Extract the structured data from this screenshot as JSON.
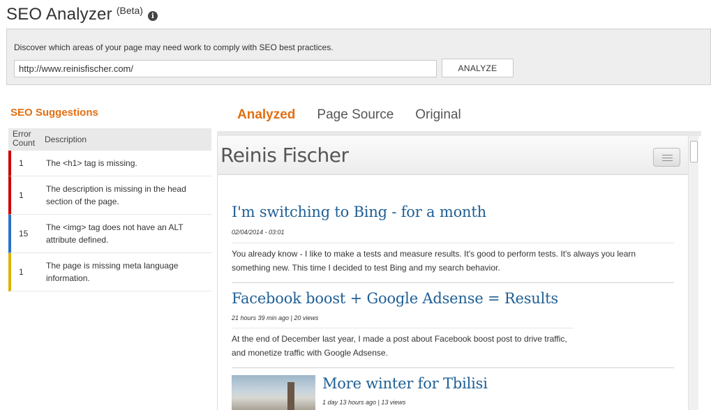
{
  "app": {
    "title": "SEO Analyzer",
    "beta": "(Beta)",
    "info_icon": "info-icon"
  },
  "panel": {
    "description": "Discover which areas of your page may need work to comply with SEO best practices.",
    "url_value": "http://www.reinisfischer.com/",
    "analyze_label": "ANALYZE"
  },
  "suggestions": {
    "title": "SEO Suggestions",
    "col_count": "Error Count",
    "col_desc": "Description",
    "rows": [
      {
        "count": "1",
        "description": "The <h1> tag is missing.",
        "color": "#cc0000"
      },
      {
        "count": "1",
        "description": "The description is missing in the head section of the page.",
        "color": "#cc0000"
      },
      {
        "count": "15",
        "description": "The <img> tag does not have an ALT attribute defined.",
        "color": "#2a73c8"
      },
      {
        "count": "1",
        "description": "The page is missing meta language information.",
        "color": "#d8b400"
      }
    ]
  },
  "tabs": [
    {
      "label": "Analyzed",
      "active": true
    },
    {
      "label": "Page Source",
      "active": false
    },
    {
      "label": "Original",
      "active": false
    }
  ],
  "preview": {
    "site_name": "Reinis Fischer",
    "menu_icon": "hamburger-menu-icon",
    "posts": [
      {
        "title": "I'm switching to Bing - for a month",
        "meta": "02/04/2014 - 03:01",
        "text": "You already know - I like to make a tests and measure results. It's good to perform tests. It's always you learn something new. This time I decided to test Bing and my search behavior."
      },
      {
        "title": "Facebook boost + Google Adsense = Results",
        "meta": "21 hours 39 min ago | 20 views",
        "text": "At the end of December last year, I made a post about Facebook boost post to drive traffic, and monetize traffic with Google Adsense."
      },
      {
        "title": "More winter for Tbilisi",
        "meta": "1 day 13 hours ago | 13 views"
      }
    ]
  },
  "colors": {
    "accent": "#e26f12",
    "link": "#1e5f95"
  }
}
